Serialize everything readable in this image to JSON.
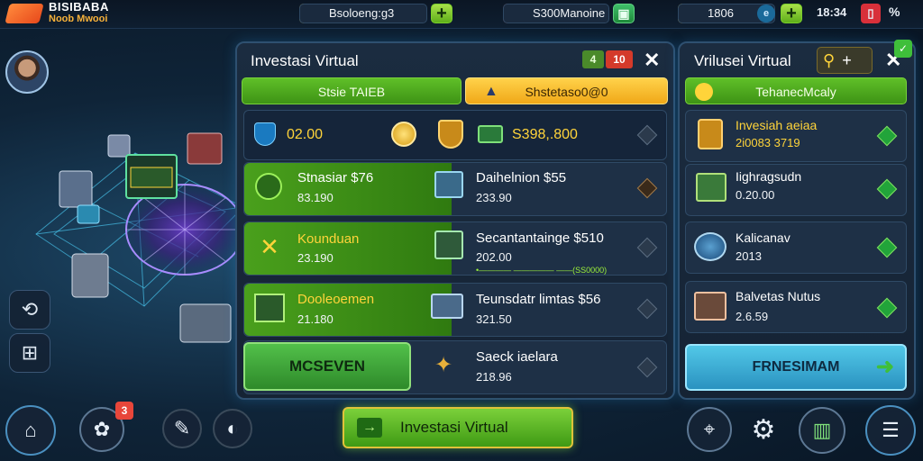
{
  "header": {
    "logo_line1": "BISIBABA",
    "logo_line2": "Noob Mwooi",
    "resource1": "Bsoloeng:g3",
    "resource2": "S300Manoine",
    "resource3": "1806",
    "time": "18:34",
    "right_icon": "%"
  },
  "main_panel": {
    "title": "Investasi Virtual",
    "tag_left": "4",
    "tag_right": "10",
    "tab_left": "Stsie TAIEB",
    "tab_right": "Shstetaso0@0",
    "summary_value1": "02.00",
    "summary_value2": "S398,.800",
    "rows": [
      {
        "left_title": "Stnasiar $76",
        "left_sub": "83.190",
        "right_title": "Daihelnion $55",
        "right_sub": "233.90"
      },
      {
        "left_title": "Kounduan",
        "left_sub": "23.190",
        "right_title": "Secantantainge $510",
        "right_sub": "202.00",
        "right_note": "•———— ————— ——(SS0000)"
      },
      {
        "left_title": "Dooleoemen",
        "left_sub": "21.180",
        "right_title": "Teunsdatr limtas $56",
        "right_sub": "321.50"
      },
      {
        "left_title": "MCSEVEN",
        "left_sub": "",
        "right_title": "Saeck iaelara",
        "right_sub": "218.96"
      }
    ]
  },
  "side_panel": {
    "title": "Vrilusei Virtual",
    "tab": "TehanecMcaly",
    "rows": [
      {
        "title": "Invesiah aeiaa",
        "sub": "2i0083 3719"
      },
      {
        "title": "Iighragsudn",
        "sub": "0.20.00"
      },
      {
        "title": "Kalicanav",
        "sub": "2013"
      },
      {
        "title": "Balvetas Nutus",
        "sub": "2.6.59"
      }
    ],
    "cta": "FRNESIMAM"
  },
  "bottom": {
    "main_cta": "Investasi Virtual",
    "badge_count": "3"
  },
  "colors": {
    "accent_green": "#5fbf28",
    "accent_gold": "#f0a818",
    "price_green": "#9bf03a",
    "panel_border": "#2e5070"
  }
}
